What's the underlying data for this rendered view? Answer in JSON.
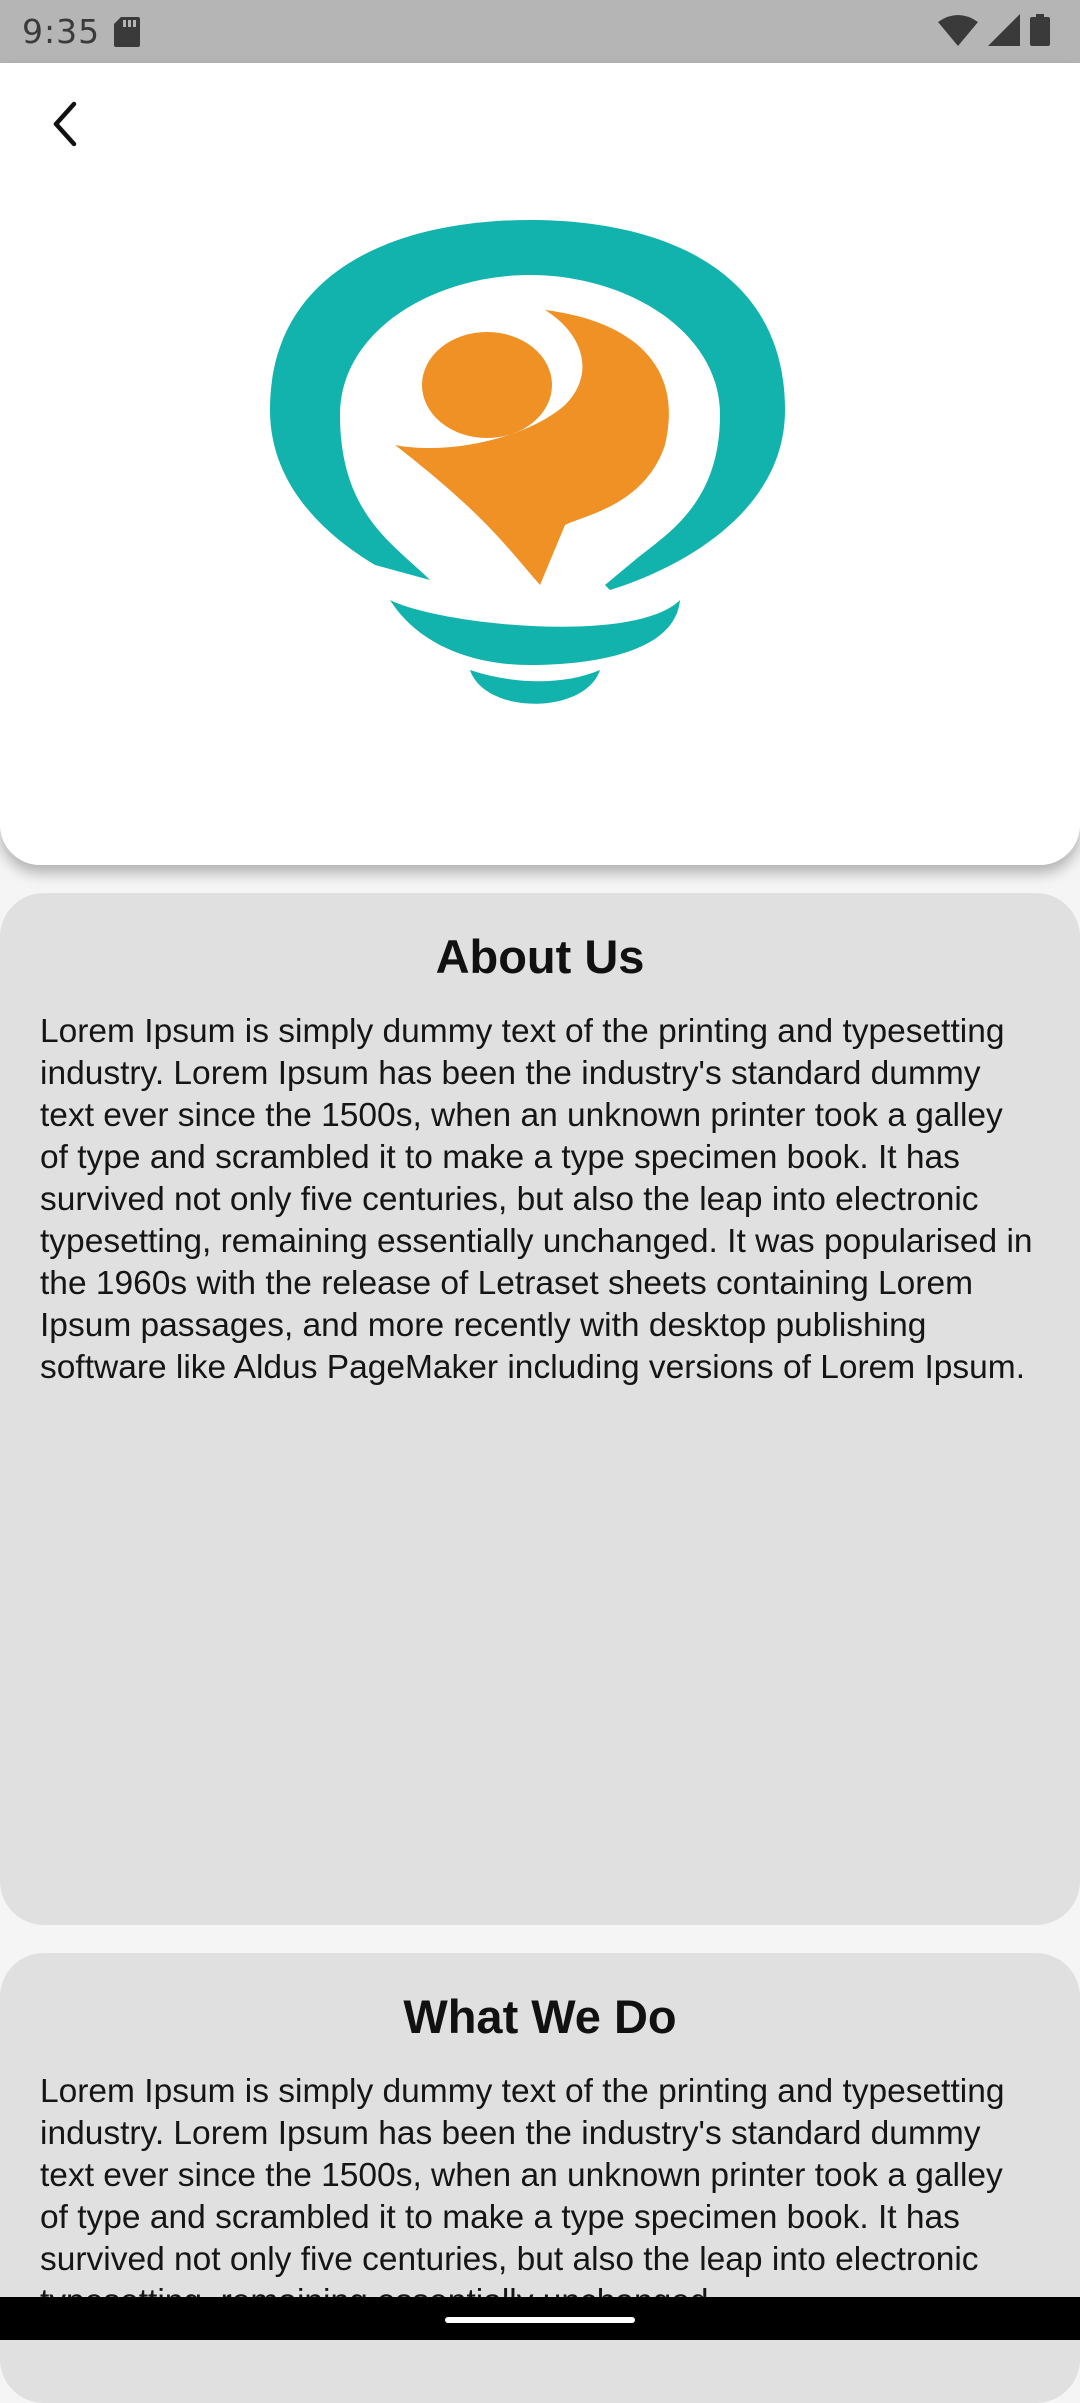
{
  "status_bar": {
    "time": "9:35",
    "icons": [
      "sd-card-icon",
      "wifi-icon",
      "cell-signal-icon",
      "battery-icon"
    ]
  },
  "header": {
    "back_icon": "chevron-left-icon",
    "logo": "lightbulb-person-logo",
    "colors": {
      "teal": "#12b3ad",
      "orange": "#ef9125"
    }
  },
  "sections": [
    {
      "title": "About Us",
      "body": "Lorem Ipsum is simply dummy text of the printing and typesetting industry. Lorem Ipsum has been the industry's standard dummy text ever since the 1500s, when an unknown printer took a galley of type and scrambled it to make a type specimen book. It has survived not only five centuries, but also the leap into electronic typesetting, remaining essentially unchanged. It was popularised in the 1960s with the release of Letraset sheets containing Lorem Ipsum passages, and more recently with desktop publishing software like Aldus PageMaker including versions of Lorem Ipsum."
    },
    {
      "title": "What We Do",
      "body": "Lorem Ipsum is simply dummy text of the printing and typesetting industry. Lorem Ipsum has been the industry's standard dummy text ever since the 1500s, when an unknown printer took a galley of type and scrambled it to make a type specimen book. It has survived not only five centuries, but also the leap into electronic typesetting, remaining essentially unchanged."
    }
  ]
}
